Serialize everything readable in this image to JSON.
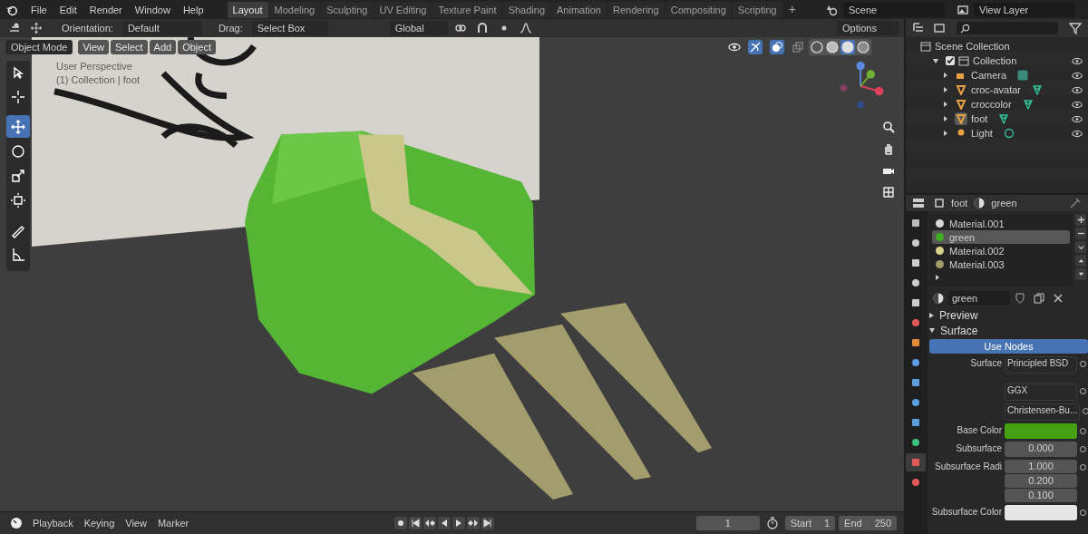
{
  "top_bar": {
    "menus": [
      "File",
      "Edit",
      "Render",
      "Window",
      "Help"
    ],
    "workspaces": [
      {
        "label": "Layout",
        "selected": true
      },
      {
        "label": "Modeling",
        "selected": false
      },
      {
        "label": "Sculpting",
        "selected": false
      },
      {
        "label": "UV Editing",
        "selected": false
      },
      {
        "label": "Texture Paint",
        "selected": false
      },
      {
        "label": "Shading",
        "selected": false
      },
      {
        "label": "Animation",
        "selected": false
      },
      {
        "label": "Rendering",
        "selected": false
      },
      {
        "label": "Compositing",
        "selected": false
      },
      {
        "label": "Scripting",
        "selected": false
      }
    ],
    "add_tab": "+",
    "scene": "Scene",
    "view_layer": "View Layer"
  },
  "tool_header": {
    "orientation_label": "Orientation:",
    "orientation": "Default",
    "drag_label": "Drag:",
    "drag": "Select Box",
    "transform_orientation": "Global",
    "options": "Options"
  },
  "viewport": {
    "mode": "Object Mode",
    "menus": [
      "View",
      "Select",
      "Add",
      "Object"
    ],
    "overlay_text": [
      "User Perspective",
      "(1) Collection | foot"
    ],
    "tools": [
      {
        "kind": "select",
        "selected": false
      },
      {
        "kind": "cursor",
        "selected": false
      },
      {
        "kind": "move",
        "selected": true
      },
      {
        "kind": "rotate",
        "selected": false
      },
      {
        "kind": "scale",
        "selected": false
      },
      {
        "kind": "transform",
        "selected": false
      },
      {
        "kind": "annotate",
        "selected": false
      },
      {
        "kind": "measure",
        "selected": false
      }
    ],
    "shading": [
      {
        "kind": "wireframe",
        "selected": false
      },
      {
        "kind": "solid",
        "selected": false
      },
      {
        "kind": "material",
        "selected": true
      },
      {
        "kind": "rendered",
        "selected": false
      }
    ]
  },
  "outliner": {
    "root": "Scene Collection",
    "collection": {
      "label": "Collection",
      "checked": true,
      "expanded": true,
      "children": [
        {
          "label": "Camera",
          "kind": "camera",
          "selected": false
        },
        {
          "label": "croc-avatar",
          "kind": "mesh",
          "selected": false
        },
        {
          "label": "croccolor",
          "kind": "mesh",
          "selected": false
        },
        {
          "label": "foot",
          "kind": "mesh",
          "selected": true
        },
        {
          "label": "Light",
          "kind": "light",
          "selected": false
        }
      ]
    }
  },
  "properties": {
    "object": "foot",
    "material": "green",
    "tabs": [
      {
        "kind": "tool",
        "selected": false
      },
      {
        "kind": "render",
        "selected": false
      },
      {
        "kind": "output",
        "selected": false
      },
      {
        "kind": "view_layer",
        "selected": false
      },
      {
        "kind": "scene",
        "selected": false
      },
      {
        "kind": "world",
        "selected": false
      },
      {
        "kind": "object",
        "selected": false
      },
      {
        "kind": "modifier",
        "selected": false
      },
      {
        "kind": "particles",
        "selected": false
      },
      {
        "kind": "physics",
        "selected": false
      },
      {
        "kind": "constraints",
        "selected": false
      },
      {
        "kind": "data",
        "selected": false
      },
      {
        "kind": "material",
        "selected": true
      },
      {
        "kind": "texture",
        "selected": false
      }
    ],
    "materials": [
      {
        "name": "Material.001",
        "color": "#d8d8d8",
        "selected": false
      },
      {
        "name": "green",
        "color": "#3fae1c",
        "selected": true
      },
      {
        "name": "Material.002",
        "color": "#d8d28a",
        "selected": false
      },
      {
        "name": "Material.003",
        "color": "#a39b6a",
        "selected": false
      }
    ],
    "material_field": "green",
    "panels": [
      {
        "label": "Preview",
        "expanded": false
      },
      {
        "label": "Surface",
        "expanded": true
      }
    ],
    "use_nodes": "Use Nodes",
    "fields": [
      {
        "kind": "dropdown",
        "label": "Surface",
        "value": "Principled BSD"
      },
      {
        "kind": "gap"
      },
      {
        "kind": "dropdown",
        "value": "GGX"
      },
      {
        "kind": "dropdown",
        "value": "Christensen-Bu..."
      },
      {
        "kind": "color",
        "label": "Base Color",
        "color": "#45a012"
      },
      {
        "kind": "number",
        "label": "Subsurface",
        "value": "0.000"
      },
      {
        "kind": "vector",
        "label": "Subsurface Radi",
        "values": [
          "1.000",
          "0.200",
          "0.100"
        ]
      },
      {
        "kind": "color",
        "label": "Subsurface Color",
        "color": "#e6e6e6"
      }
    ]
  },
  "timeline": {
    "menus": [
      "Playback",
      "Keying",
      "View",
      "Marker"
    ],
    "current_frame": "1",
    "start_label": "Start",
    "start": "1",
    "end_label": "End",
    "end": "250"
  }
}
